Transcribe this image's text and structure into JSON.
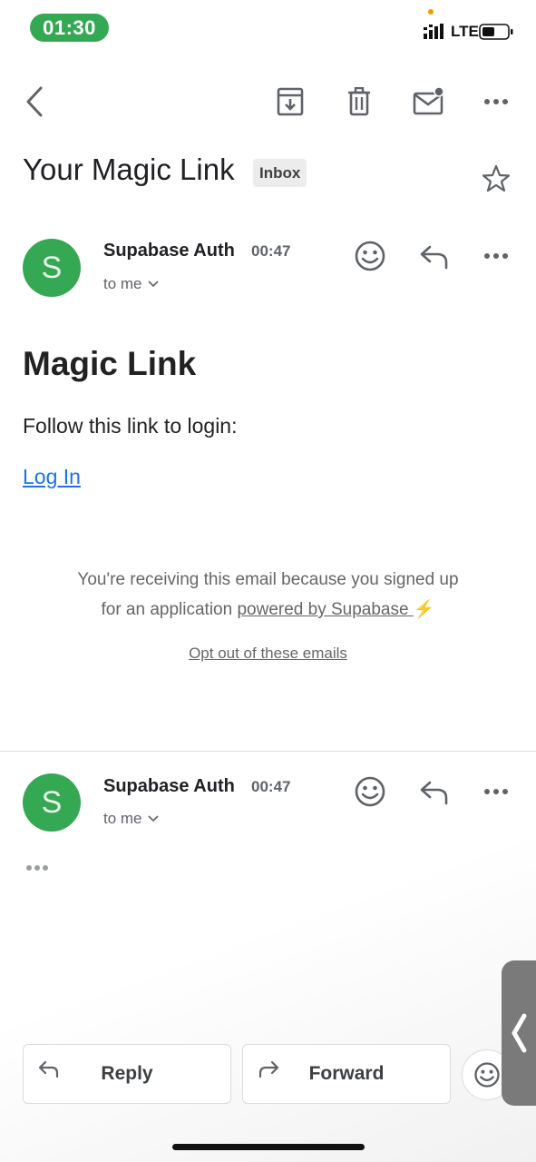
{
  "status_bar": {
    "time": "01:30",
    "network": "LTE"
  },
  "email": {
    "subject": "Your Magic Link",
    "label": "Inbox",
    "messages": [
      {
        "avatar_letter": "S",
        "sender": "Supabase Auth",
        "time": "00:47",
        "recipient": "to me"
      },
      {
        "avatar_letter": "S",
        "sender": "Supabase Auth",
        "time": "00:47",
        "recipient": "to me"
      }
    ],
    "body": {
      "heading": "Magic Link",
      "text": "Follow this link to login:",
      "link": "Log In",
      "footer_line1": "You're receiving this email because you signed up",
      "footer_line2_prefix": "for an application ",
      "footer_link": "powered by Supabase ",
      "footer_emoji": "⚡",
      "optout": "Opt out of these emails"
    }
  },
  "actions": {
    "reply": "Reply",
    "forward": "Forward"
  },
  "colors": {
    "accent_green": "#34a853",
    "link_blue": "#1a73e8"
  }
}
